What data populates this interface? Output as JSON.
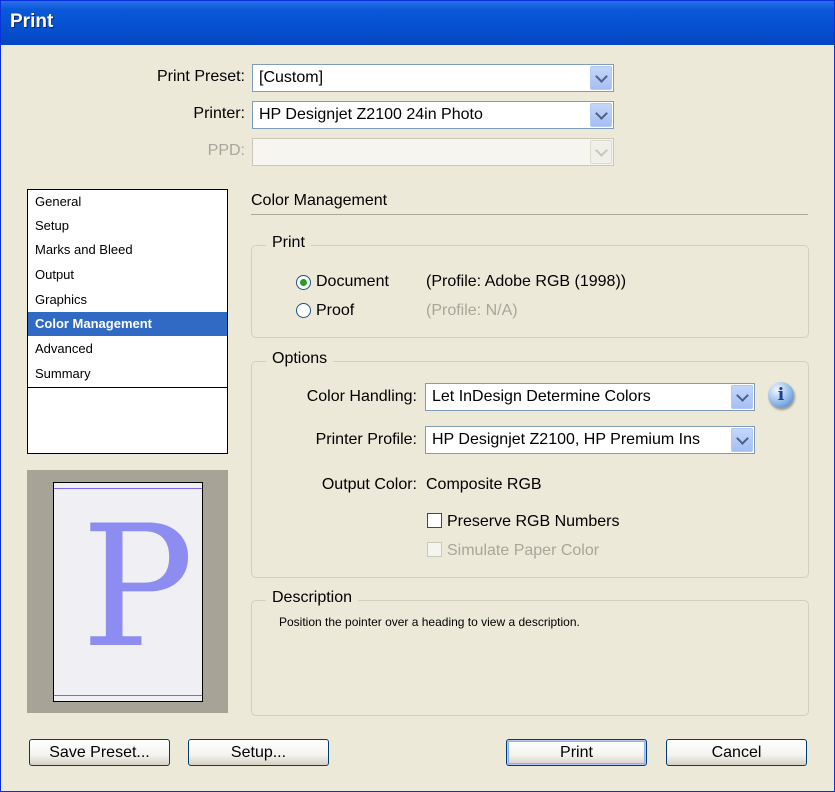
{
  "window": {
    "title": "Print"
  },
  "top": {
    "preset_label": "Print Preset:",
    "preset_value": "[Custom]",
    "printer_label": "Printer:",
    "printer_value": "HP Designjet Z2100 24in Photo",
    "ppd_label": "PPD:",
    "ppd_value": ""
  },
  "sidebar": {
    "items": [
      {
        "label": "General"
      },
      {
        "label": "Setup"
      },
      {
        "label": "Marks and Bleed"
      },
      {
        "label": "Output"
      },
      {
        "label": "Graphics"
      },
      {
        "label": "Color Management",
        "selected": true
      },
      {
        "label": "Advanced"
      },
      {
        "label": "Summary"
      }
    ]
  },
  "preview": {
    "letter": "P"
  },
  "main": {
    "section_title": "Color Management",
    "print_group": {
      "title": "Print",
      "document_label": "Document",
      "document_profile": "(Profile: Adobe RGB (1998))",
      "document_selected": true,
      "proof_label": "Proof",
      "proof_profile": "(Profile: N/A)"
    },
    "options_group": {
      "title": "Options",
      "color_handling_label": "Color Handling:",
      "color_handling_value": "Let InDesign Determine Colors",
      "printer_profile_label": "Printer Profile:",
      "printer_profile_value": "HP Designjet Z2100, HP Premium Ins",
      "output_color_label": "Output Color:",
      "output_color_value": "Composite RGB",
      "preserve_rgb_label": "Preserve RGB Numbers",
      "simulate_paper_label": "Simulate Paper Color",
      "info_icon": "info-icon"
    },
    "description_group": {
      "title": "Description",
      "text": "Position the pointer over a heading to view a description."
    }
  },
  "buttons": {
    "save_preset": "Save Preset...",
    "setup": "Setup...",
    "print": "Print",
    "cancel": "Cancel"
  },
  "colors": {
    "titlebar": "#0a58d8",
    "selection": "#316ac5",
    "dialog_bg": "#ece9d8",
    "preview_letter": "#8d8cf0"
  }
}
